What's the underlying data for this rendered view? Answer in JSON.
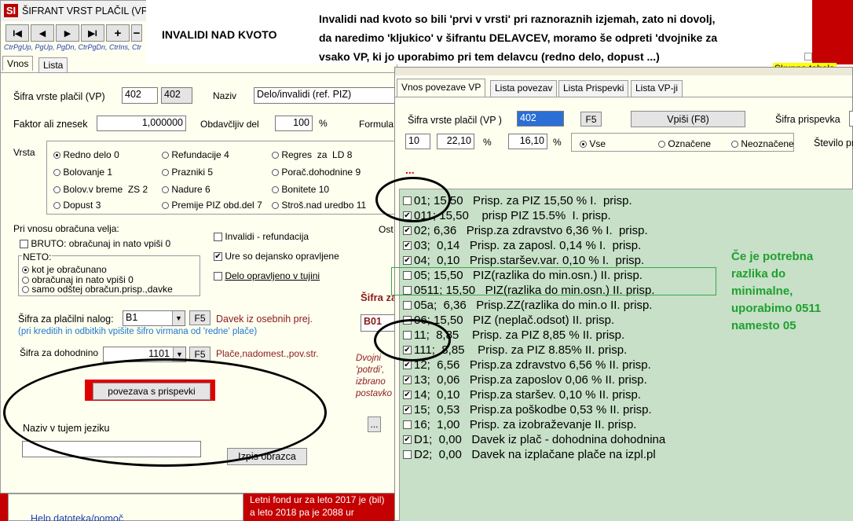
{
  "main_window": {
    "title": "ŠIFRANT VRST PLAČIL  (VP)",
    "nav_buttons": [
      "I◀",
      "◀",
      "▶",
      "▶I",
      "+",
      "−"
    ],
    "nav_hints": "CtrPgUp, PgUp, PgDn, CtrPgDn, CtrIns, Ctr",
    "tabs": [
      "Vnos",
      "Lista"
    ],
    "sifra_label": "Šifra vrste plačil (VP)",
    "sifra_value": "402",
    "sifra_value2": "402",
    "naziv_label": "Naziv",
    "naziv_value": "Delo/invalidi (ref. PIZ)",
    "faktor_label": "Faktor ali znesek",
    "faktor_value": "1,000000",
    "obdavcljiv_label": "Obdavčljiv del",
    "obdavcljiv_value": "100",
    "percent": "%",
    "formula_label": "Formula",
    "vrsta_label": "Vrsta",
    "vrsta_options": [
      {
        "label": "Redno delo",
        "num": "0",
        "selected": true
      },
      {
        "label": "Refundacije",
        "num": "4",
        "selected": false
      },
      {
        "label": "Regres  za  LD",
        "num": "8",
        "selected": false
      },
      {
        "label": "Bolovanje",
        "num": "1",
        "selected": false
      },
      {
        "label": "Prazniki",
        "num": "5",
        "selected": false
      },
      {
        "label": "Porač.dohodnine",
        "num": "9",
        "selected": false
      },
      {
        "label": "Bolov.v breme  ZS",
        "num": "2",
        "selected": false
      },
      {
        "label": "Nadure",
        "num": "6",
        "selected": false
      },
      {
        "label": "Bonitete",
        "num": "10",
        "selected": false
      },
      {
        "label": "Dopust",
        "num": "3",
        "selected": false
      },
      {
        "label": "Premije PIZ obd.del",
        "num": "7",
        "selected": false
      },
      {
        "label": "Stroš.nad uredbo",
        "num": "11",
        "selected": false
      }
    ],
    "pri_vnosu_label": "Pri vnosu obračuna  velja:",
    "bruto_label": "BRUTO: obračunaj in nato vpiši 0",
    "neto_label": "NETO:",
    "neto_options": [
      {
        "label": "kot je obračunano",
        "selected": true
      },
      {
        "label": "obračunaj in nato vpiši 0",
        "selected": false
      },
      {
        "label": "samo odštej obračun.prisp.,davke",
        "selected": false
      }
    ],
    "invalidi_label": "Invalidi - refundacija",
    "ure_label": "Ure so dejansko opravljene",
    "delo_tujini_label": "Delo opravljeno v tujini",
    "ost_label": "Ost",
    "placilni_label": "Šifra za plačilni nalog:",
    "placilni_value": "B1",
    "f5": "F5",
    "davek_label": "Davek iz osebnih prej.",
    "kreditih_hint": "(pri kreditih in odbitkih vpišite šifro virmana od 'redne' plače)",
    "dohodnino_label": "Šifra za dohodnino",
    "dohodnino_value": "1101",
    "place_label": "Plače,nadomest.,pov.str.",
    "sifra_za_label": "Šifra za",
    "b01_value": "B01",
    "dvojni_text": [
      "Dvojni",
      "'potrdi',",
      "izbrano",
      "postavko"
    ],
    "povezava_button": "povezava s prispevki",
    "naziv_tujem_label": "Naziv v tujem jeziku",
    "naziv_tujem_value": "",
    "izpis_button": "Izpis obrazca",
    "dots_button": "..."
  },
  "invalidi_title": "INVALIDI NAD KVOTO",
  "top_note": [
    "Invalidi nad kvoto so bili 'prvi v vrsti' pri raznoraznih izjemah, zato ni dovolj,",
    "da naredimo 'kljukico' v    šifrantu DELAVCEV, moramo še odpreti 'dvojnike za",
    "vsako VP, ki jo uporabimo pri tem delavcu (redno delo, dopust ...)"
  ],
  "skupna_tabela": "Skupna tabela",
  "bottom_left": {
    "help_text": "Help datoteka/pomoč",
    "letni_fond": [
      "Letni fond ur za leto 2017 je (bil)",
      "a leto 2018 pa je 2088 ur"
    ]
  },
  "dialog": {
    "tabs": [
      "Vnos povezave VP",
      "Lista povezav",
      "Lista Prispevki",
      "Lista VP-ji"
    ],
    "sifra_label": "Šifra vrste plačil (VP )",
    "sifra_value": "402",
    "f5": "F5",
    "vpisi_button": "Vpiši  (F8)",
    "sifra_prispevka_label": "Šifra prispevka",
    "stevilo_label": "Število pr",
    "field_a": "10",
    "field_b": "22,10",
    "field_c": "16,10",
    "percent": "%",
    "filter_options": [
      {
        "label": "Vse",
        "selected": true
      },
      {
        "label": "Označene",
        "selected": false
      },
      {
        "label": "Neoznačene",
        "selected": false
      }
    ],
    "dots": "...",
    "list": [
      {
        "checked": false,
        "text": "01; 15,50   Prisp. za PIZ 15,50 % I.  prisp."
      },
      {
        "checked": true,
        "text": "011; 15,50    prisp PIZ 15.5%  I. prisp."
      },
      {
        "checked": true,
        "text": "02; 6,36   Prisp.za zdravstvo 6,36 % I.  prisp."
      },
      {
        "checked": true,
        "text": "03;  0,14   Prisp. za zaposl. 0,14 % I.  prisp."
      },
      {
        "checked": true,
        "text": "04;  0,10   Prisp.staršev.var. 0,10 % I.  prisp."
      },
      {
        "checked": false,
        "text": "05; 15,50   PIZ(razlika do min.osn.) II. prisp."
      },
      {
        "checked": false,
        "text": "0511; 15,50   PIZ(razlika do min.osn.) II. prisp."
      },
      {
        "checked": false,
        "text": "05a;  6,36   Prisp.ZZ(razlika do min.o II. prisp."
      },
      {
        "checked": false,
        "text": "06; 15,50   PIZ (neplač.odsot) II. prisp."
      },
      {
        "checked": false,
        "text": "11;  8,85    Prisp. za PIZ 8,85 % II. prisp."
      },
      {
        "checked": true,
        "text": "111;  8,85    Prisp. za PIZ 8.85% II. prisp."
      },
      {
        "checked": true,
        "text": "12;  6,56   Prisp.za zdravstvo 6,56 % II. prisp."
      },
      {
        "checked": true,
        "text": "13;  0,06   Prisp.za zaposlov 0,06 % II. prisp."
      },
      {
        "checked": true,
        "text": "14;  0,10   Prisp.za staršev. 0,10 % II. prisp."
      },
      {
        "checked": true,
        "text": "15;  0,53   Prisp.za poškodbe 0,53 % II. prisp."
      },
      {
        "checked": false,
        "text": "16;  1,00   Prisp. za izobraževanje II. prisp."
      },
      {
        "checked": true,
        "text": "D1;  0,00   Davek iz plač - dohodnina dohodnina"
      },
      {
        "checked": false,
        "text": "D2;  0,00   Davek na izplačane plače na izpl.pl"
      }
    ]
  },
  "green_note": [
    "Če je potrebna",
    "razlika do",
    "minimalne,",
    "uporabimo 0511",
    "namesto  05"
  ],
  "colors": {
    "list_bg": "#c7e0c7",
    "window_bg": "#fffff0",
    "accent_red": "#e00000",
    "green_text": "#1fa02f",
    "hint_blue": "#1e78d0",
    "dark_red": "#8b1a1a"
  }
}
